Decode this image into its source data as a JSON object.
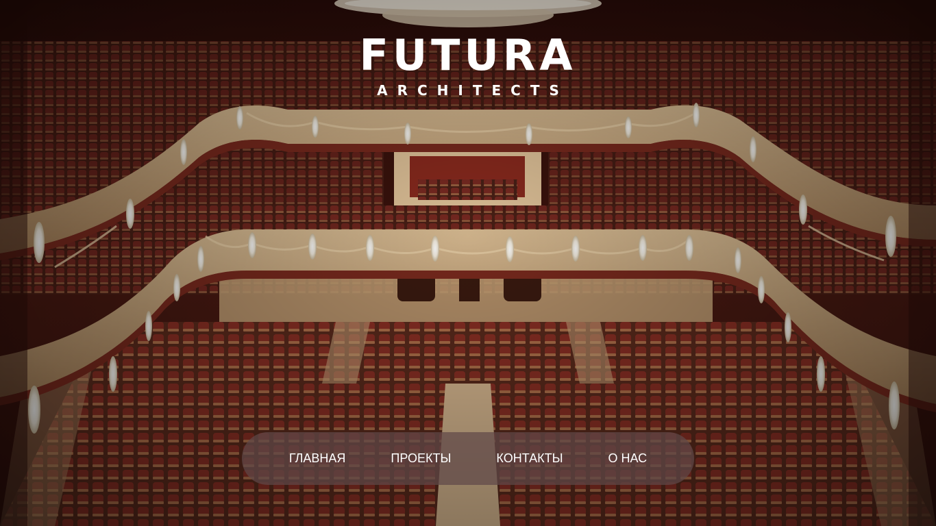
{
  "logo": {
    "title": "FUTURA",
    "subtitle": "ARCHITECTS"
  },
  "nav": {
    "items": [
      {
        "label": "ГЛАВНАЯ"
      },
      {
        "label": "ПРОЕКТЫ"
      },
      {
        "label": "КОНТАКТЫ"
      },
      {
        "label": "О НАС"
      }
    ]
  },
  "colors": {
    "nav_background": "#5f4848",
    "text": "#ffffff",
    "seat": "#7a2a22",
    "balcony": "#c9a77a"
  }
}
